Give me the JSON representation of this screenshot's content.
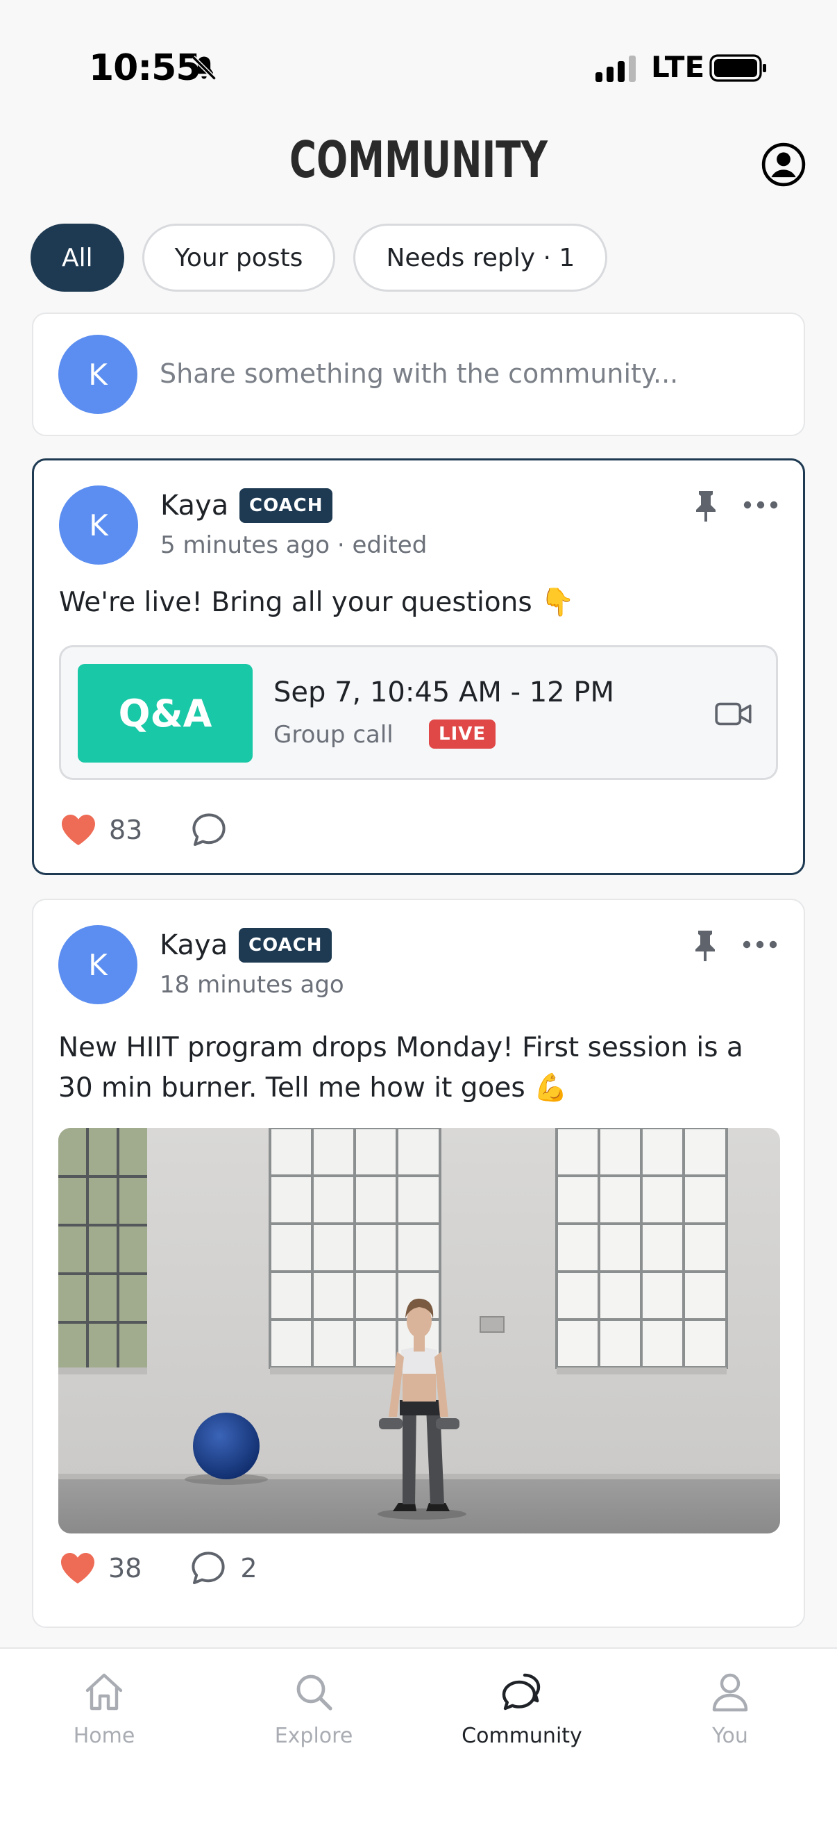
{
  "status_bar": {
    "time": "10:55",
    "network": "LTE",
    "icons": [
      "bell-off-icon",
      "signal-icon",
      "battery-icon"
    ]
  },
  "header": {
    "title": "COMMUNITY",
    "account_icon": "account-circle-icon"
  },
  "filters": [
    {
      "label": "All",
      "active": true
    },
    {
      "label": "Your posts",
      "active": false
    },
    {
      "label": "Needs reply · 1",
      "active": false
    }
  ],
  "composer": {
    "avatar_initial": "K",
    "placeholder": "Share something with the community..."
  },
  "posts": [
    {
      "author": "Kaya",
      "avatar_initial": "K",
      "badge": "COACH",
      "timestamp": "5 minutes ago · edited",
      "pinned": true,
      "text": "We're live! Bring all your questions 👇",
      "event": {
        "thumb_label": "Q&A",
        "date": "Sep 7, 10:45 AM - 12 PM",
        "type": "Group call",
        "status": "LIVE"
      },
      "likes": "83",
      "comments": ""
    },
    {
      "author": "Kaya",
      "avatar_initial": "K",
      "badge": "COACH",
      "timestamp": "18 minutes ago",
      "pinned": true,
      "text": "New HIIT program drops Monday! First session is a 30 min burner. Tell me how it goes 💪",
      "image": "woman-with-dumbbells-in-gym-photo",
      "likes": "38",
      "comments": "2"
    }
  ],
  "tabs": [
    {
      "label": "Home",
      "icon": "home-icon",
      "active": false
    },
    {
      "label": "Explore",
      "icon": "search-icon",
      "active": false
    },
    {
      "label": "Community",
      "icon": "chat-bubbles-icon",
      "active": true
    },
    {
      "label": "You",
      "icon": "person-icon",
      "active": false
    }
  ],
  "colors": {
    "brand_navy": "#1e3a52",
    "avatar_blue": "#5b8ef0",
    "event_teal": "#18c8a6",
    "live_red": "#e04848",
    "heart": "#ee6b55"
  }
}
